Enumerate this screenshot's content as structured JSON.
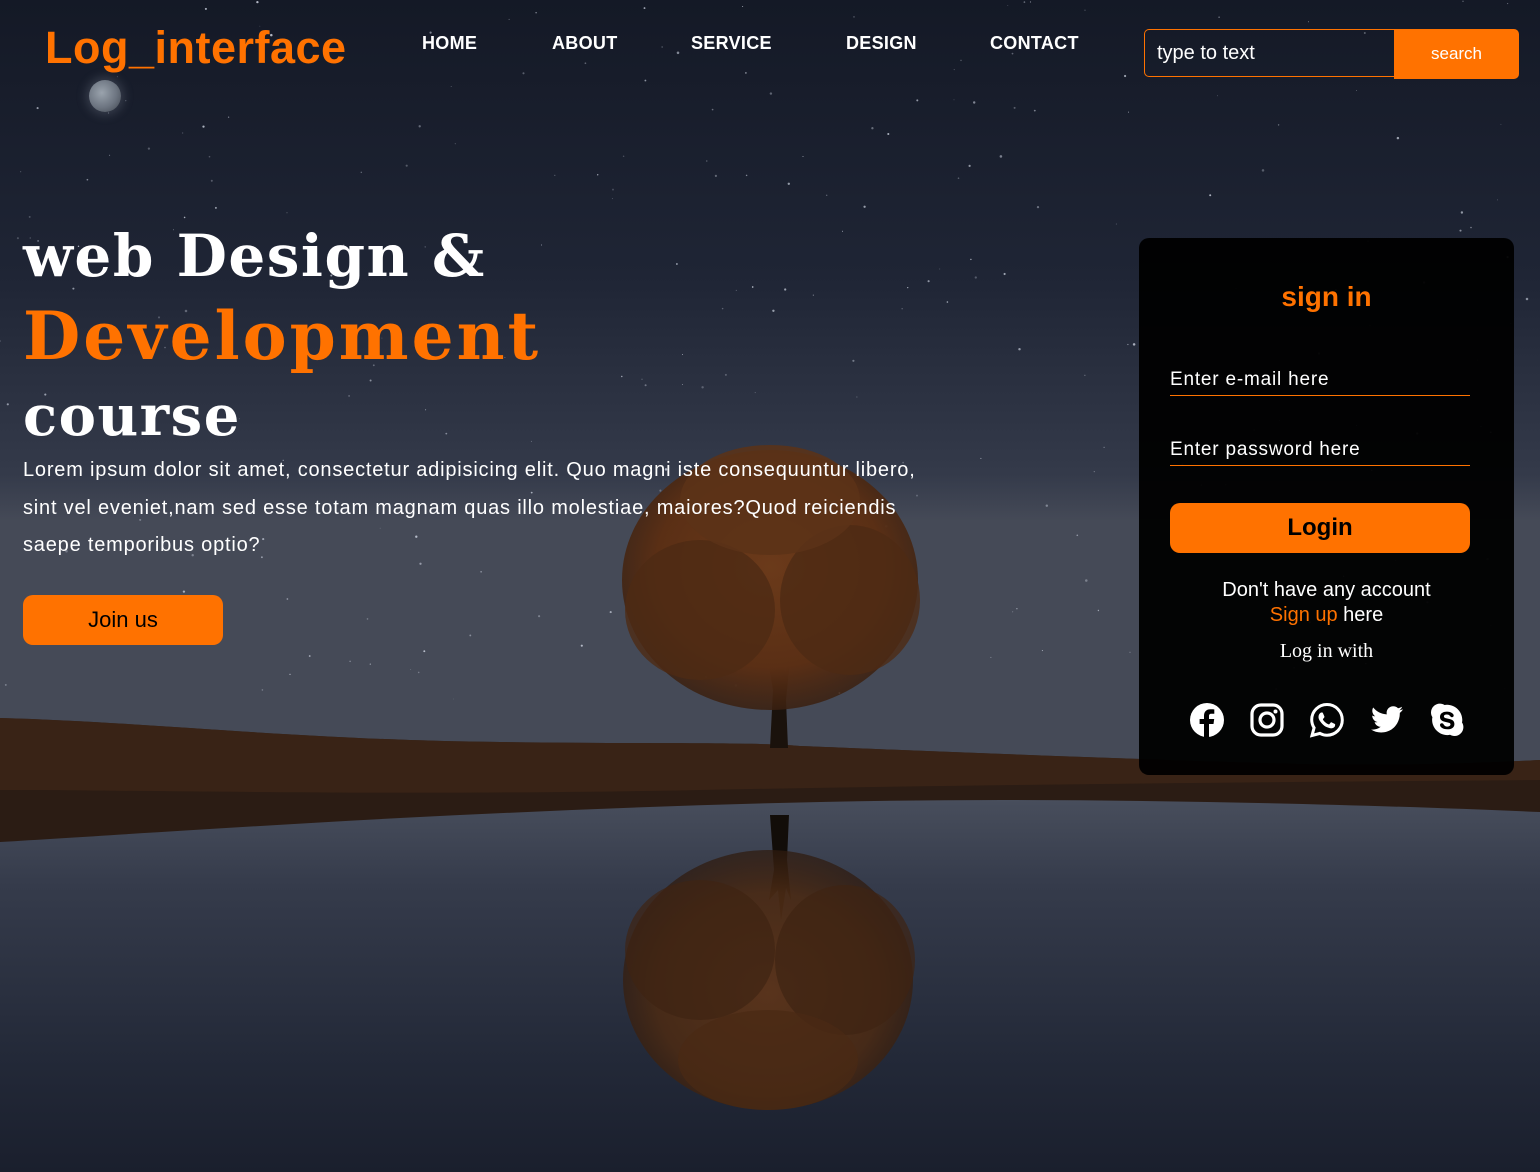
{
  "brand": {
    "logo": "Log_interface"
  },
  "nav": {
    "items": [
      "HOME",
      "ABOUT",
      "SERVICE",
      "DESIGN",
      "CONTACT"
    ]
  },
  "search": {
    "placeholder": "type to text",
    "button_label": "search"
  },
  "hero": {
    "line1": "web Design &",
    "line2": "Development",
    "line3": "course",
    "description": "Lorem ipsum dolor sit amet, consectetur adipisicing elit. Quo magni iste consequuntur libero, sint vel eveniet,nam sed esse totam magnam quas illo molestiae, maiores?Quod reiciendis saepe temporibus optio?",
    "cta_label": "Join us"
  },
  "signin": {
    "title": "sign in",
    "email_placeholder": "Enter e-mail here",
    "password_placeholder": "Enter password here",
    "login_label": "Login",
    "no_account_text": "Don't have any account",
    "signup_link": "Sign up",
    "signup_suffix": " here",
    "log_in_with": "Log in with",
    "social_icons": [
      "facebook-icon",
      "instagram-icon",
      "whatsapp-icon",
      "twitter-icon",
      "skype-icon"
    ]
  },
  "colors": {
    "accent": "#ff7200",
    "panel": "#000000",
    "sky_top": "#131826",
    "sky_horizon": "#3e4455"
  }
}
